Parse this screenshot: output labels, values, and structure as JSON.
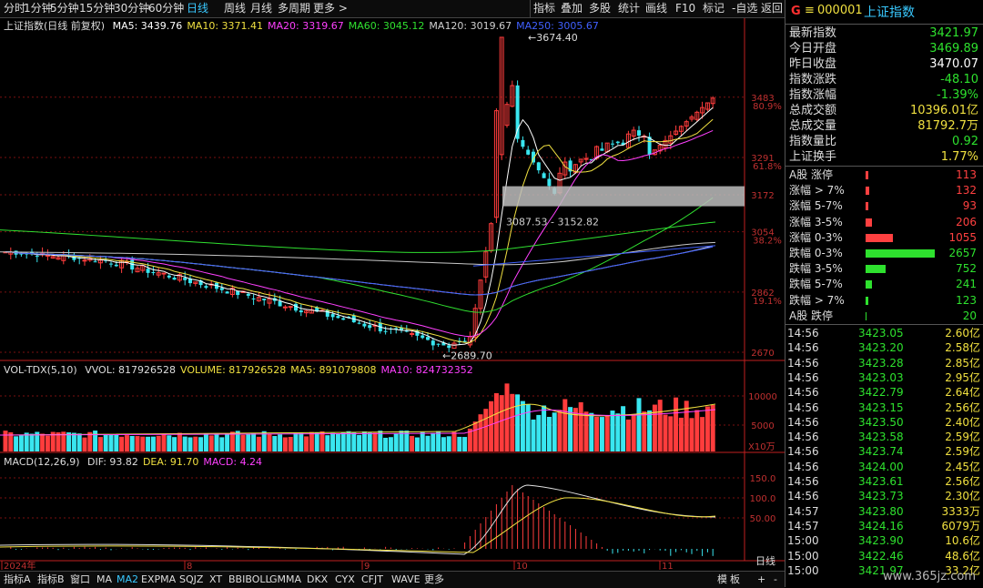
{
  "periods": [
    "分时",
    "1分钟",
    "5分钟",
    "15分钟",
    "30分钟",
    "60分钟",
    "日线",
    "周线",
    "月线",
    "多周期",
    "更多 >"
  ],
  "active_period": "日线",
  "tools": [
    "指标",
    "叠加",
    "多股",
    "统计",
    "画线",
    "F10",
    "标记",
    "-自选",
    "返回"
  ],
  "main": {
    "name": "上证指数(日线 前复权)",
    "ma": [
      {
        "label": "MA5: 3439.76",
        "color": "#ffffff"
      },
      {
        "label": "MA10: 3371.41",
        "color": "#f0e040"
      },
      {
        "label": "MA20: 3319.67",
        "color": "#ff40ff"
      },
      {
        "label": "MA60: 3045.12",
        "color": "#30e030"
      },
      {
        "label": "MA120: 3019.67",
        "color": "#d0d0d0"
      },
      {
        "label": "MA250: 3005.67",
        "color": "#4060ff"
      }
    ],
    "high_label": "3674.40",
    "low_label": "2689.70",
    "range_label": "3087.53 - 3152.82",
    "axis_prices": [
      "3483",
      "3291",
      "3172",
      "3054",
      "2862",
      "2670"
    ],
    "axis_pcts": [
      "80.9%",
      "61.8%",
      "38.2%",
      "19.1%"
    ]
  },
  "vol": {
    "title": "VOL-TDX(5,10)",
    "items": [
      {
        "label": "VVOL: 817926528",
        "color": "#dddddd"
      },
      {
        "label": "VOLUME: 817926528",
        "color": "#f0e040"
      },
      {
        "label": "MA5: 891079808",
        "color": "#f0e040"
      },
      {
        "label": "MA10: 824732352",
        "color": "#ff40ff"
      }
    ],
    "axis": [
      "10000",
      "5000"
    ],
    "unit": "X10万"
  },
  "macd": {
    "title": "MACD(12,26,9)",
    "items": [
      {
        "label": "DIF: 93.82",
        "color": "#dddddd"
      },
      {
        "label": "DEA: 91.70",
        "color": "#f0e040"
      },
      {
        "label": "MACD: 4.24",
        "color": "#ff40ff"
      }
    ],
    "axis": [
      "150.0",
      "100.0",
      "50.00"
    ]
  },
  "dates": [
    "2024年",
    "8",
    "9",
    "10",
    "11"
  ],
  "bottom_tabs": [
    "指标A",
    "指标B",
    "窗口",
    "MA",
    "MA2",
    "EXPMA",
    "SQJZ",
    "XT",
    "BBIBOLL",
    "GMMA",
    "DKX",
    "CYX",
    "CFJT",
    "WAVE",
    "更多"
  ],
  "active_bottom": "MA2",
  "bottom_right": [
    "模",
    "板",
    "日线",
    "+",
    "-"
  ],
  "stock": {
    "g": "G",
    "icon": "≡",
    "code": "000001",
    "name": "上证指数",
    "rows": [
      {
        "label": "最新指数",
        "value": "3421.97",
        "color": "#2ee12e"
      },
      {
        "label": "今日开盘",
        "value": "3469.89",
        "color": "#2ee12e"
      },
      {
        "label": "昨日收盘",
        "value": "3470.07",
        "color": "#ffffff"
      },
      {
        "label": "指数涨跌",
        "value": "-48.10",
        "color": "#2ee12e"
      },
      {
        "label": "指数涨幅",
        "value": "-1.39%",
        "color": "#2ee12e"
      },
      {
        "label": "总成交额",
        "value": "10396.01亿",
        "color": "#f0e040"
      },
      {
        "label": "总成交量",
        "value": "81792.7万",
        "color": "#f0e040"
      },
      {
        "label": "指数量比",
        "value": "0.92",
        "color": "#2ee12e"
      },
      {
        "label": "上证换手",
        "value": "1.77%",
        "color": "#f0e040"
      }
    ],
    "breadth": [
      {
        "label": "A股 涨停",
        "value": "113",
        "color": "#ff4040",
        "bar": 3
      },
      {
        "label": "涨幅 > 7%",
        "value": "132",
        "color": "#ff4040",
        "bar": 4
      },
      {
        "label": "涨幅 5-7%",
        "value": "93",
        "color": "#ff4040",
        "bar": 3
      },
      {
        "label": "涨幅 3-5%",
        "value": "206",
        "color": "#ff4040",
        "bar": 7
      },
      {
        "label": "涨幅 0-3%",
        "value": "1055",
        "color": "#ff4040",
        "bar": 30
      },
      {
        "label": "跌幅 0-3%",
        "value": "2657",
        "color": "#2ee12e",
        "bar": 76
      },
      {
        "label": "跌幅 3-5%",
        "value": "752",
        "color": "#2ee12e",
        "bar": 22
      },
      {
        "label": "跌幅 5-7%",
        "value": "241",
        "color": "#2ee12e",
        "bar": 7
      },
      {
        "label": "跌幅 > 7%",
        "value": "123",
        "color": "#2ee12e",
        "bar": 3
      },
      {
        "label": "A股 跌停",
        "value": "20",
        "color": "#2ee12e",
        "bar": 1
      }
    ],
    "ticks": [
      {
        "t": "14:56",
        "p": "3423.05",
        "a": "2.60亿"
      },
      {
        "t": "14:56",
        "p": "3423.20",
        "a": "2.58亿"
      },
      {
        "t": "14:56",
        "p": "3423.28",
        "a": "2.85亿"
      },
      {
        "t": "14:56",
        "p": "3423.03",
        "a": "2.95亿"
      },
      {
        "t": "14:56",
        "p": "3422.79",
        "a": "2.64亿"
      },
      {
        "t": "14:56",
        "p": "3423.15",
        "a": "2.56亿"
      },
      {
        "t": "14:56",
        "p": "3423.50",
        "a": "2.40亿"
      },
      {
        "t": "14:56",
        "p": "3423.58",
        "a": "2.59亿"
      },
      {
        "t": "14:56",
        "p": "3423.74",
        "a": "2.59亿"
      },
      {
        "t": "14:56",
        "p": "3424.00",
        "a": "2.45亿"
      },
      {
        "t": "14:56",
        "p": "3423.61",
        "a": "2.56亿"
      },
      {
        "t": "14:56",
        "p": "3423.73",
        "a": "2.30亿"
      },
      {
        "t": "14:57",
        "p": "3423.80",
        "a": "3333万"
      },
      {
        "t": "14:57",
        "p": "3424.16",
        "a": "6079万"
      },
      {
        "t": "15:00",
        "p": "3423.90",
        "a": "10.6亿"
      },
      {
        "t": "15:00",
        "p": "3422.46",
        "a": "48.6亿"
      },
      {
        "t": "15:00",
        "p": "3421.97",
        "a": "33.2亿"
      }
    ]
  },
  "watermark": "www.365jz.com"
}
